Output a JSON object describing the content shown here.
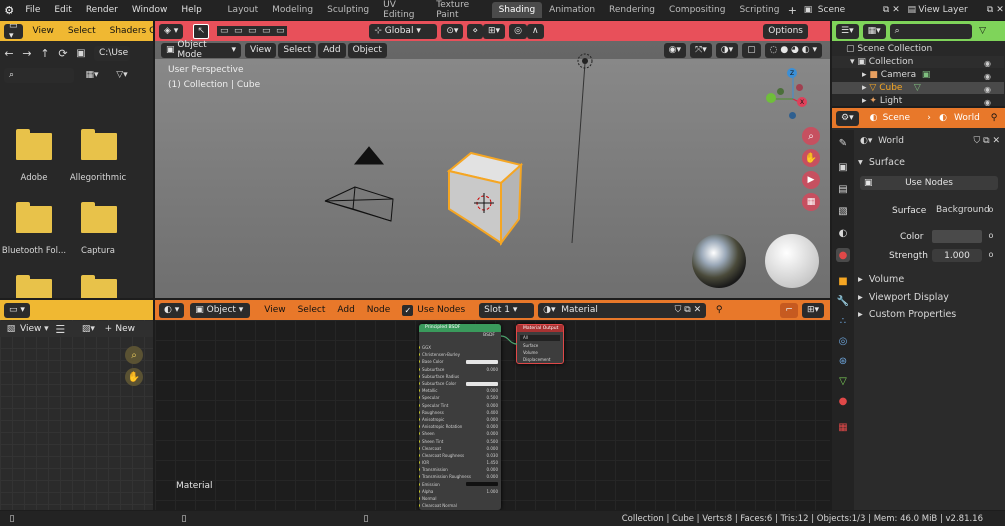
{
  "topbar": {
    "menus": [
      "File",
      "Edit",
      "Render",
      "Window",
      "Help"
    ],
    "workspaces": [
      "Layout",
      "Modeling",
      "Sculpting",
      "UV Editing",
      "Texture Paint",
      "Shading",
      "Animation",
      "Rendering",
      "Compositing",
      "Scripting"
    ],
    "scene": "Scene",
    "view_layer": "View Layer"
  },
  "filebrowser": {
    "header_view": "View",
    "header_select": "Select",
    "editor_name": "Shaders C",
    "path": "C:\\Use",
    "folders": [
      "Adobe",
      "Allegorithmic",
      "Bluetooth Fol...",
      "Captura",
      "",
      ""
    ]
  },
  "imageeditor": {
    "view": "View",
    "new": "New"
  },
  "viewport": {
    "mode": "Object Mode",
    "menus": [
      "View",
      "Select",
      "Add",
      "Object"
    ],
    "orientation": "Global",
    "options": "Options",
    "perspective": "User Perspective",
    "collection_info": "(1) Collection | Cube",
    "axes": {
      "x": "X",
      "y": "Y",
      "z": "Z"
    }
  },
  "nodeeditor": {
    "type": "Object",
    "menus": [
      "View",
      "Select",
      "Add",
      "Node"
    ],
    "use_nodes": "Use Nodes",
    "slot": "Slot 1",
    "material": "Material",
    "footer_label": "Material",
    "bsdf": {
      "title": "Principled BSDF",
      "out": "BSDF",
      "rows": [
        {
          "l": "GGX",
          "v": ""
        },
        {
          "l": "Christensen-Burley",
          "v": ""
        },
        {
          "l": "Base Color",
          "v": "bar"
        },
        {
          "l": "Subsurface",
          "v": "0.000"
        },
        {
          "l": "Subsurface Radius",
          "v": ""
        },
        {
          "l": "Subsurface Color",
          "v": "bar"
        },
        {
          "l": "Metallic",
          "v": "0.000"
        },
        {
          "l": "Specular",
          "v": "0.500"
        },
        {
          "l": "Specular Tint",
          "v": "0.000"
        },
        {
          "l": "Roughness",
          "v": "0.400"
        },
        {
          "l": "Anisotropic",
          "v": "0.000"
        },
        {
          "l": "Anisotropic Rotation",
          "v": "0.000"
        },
        {
          "l": "Sheen",
          "v": "0.000"
        },
        {
          "l": "Sheen Tint",
          "v": "0.500"
        },
        {
          "l": "Clearcoat",
          "v": "0.000"
        },
        {
          "l": "Clearcoat Roughness",
          "v": "0.030"
        },
        {
          "l": "IOR",
          "v": "1.450"
        },
        {
          "l": "Transmission",
          "v": "0.000"
        },
        {
          "l": "Transmission Roughness",
          "v": "0.000"
        },
        {
          "l": "Emission",
          "v": "dark"
        },
        {
          "l": "Alpha",
          "v": "1.000"
        },
        {
          "l": "Normal",
          "v": ""
        },
        {
          "l": "Clearcoat Normal",
          "v": ""
        }
      ]
    },
    "output": {
      "title": "Material Output",
      "target": "All",
      "rows": [
        "Surface",
        "Volume",
        "Displacement"
      ]
    }
  },
  "outliner": {
    "root": "Scene Collection",
    "items": [
      "Collection",
      "Camera",
      "Cube",
      "Light"
    ]
  },
  "properties": {
    "scene_tab": "Scene",
    "world_tab": "World",
    "world_name": "World",
    "surface_panel": "Surface",
    "use_nodes": "Use Nodes",
    "surface_label": "Surface",
    "surface_value": "Background",
    "color_label": "Color",
    "strength_label": "Strength",
    "strength_value": "1.000",
    "panels": [
      "Volume",
      "Viewport Display",
      "Custom Properties"
    ]
  },
  "statusbar": {
    "text": "Collection | Cube | Verts:8 | Faces:6 | Tris:12 | Objects:1/3 | Mem: 46.0 MiB | v2.81.16"
  },
  "colors": {
    "accent": "#e8782a",
    "viewport_header": "#e8505a",
    "node_header": "#e8782a",
    "outliner_header": "#7fd45a",
    "selected_orange": "#f5a623"
  }
}
